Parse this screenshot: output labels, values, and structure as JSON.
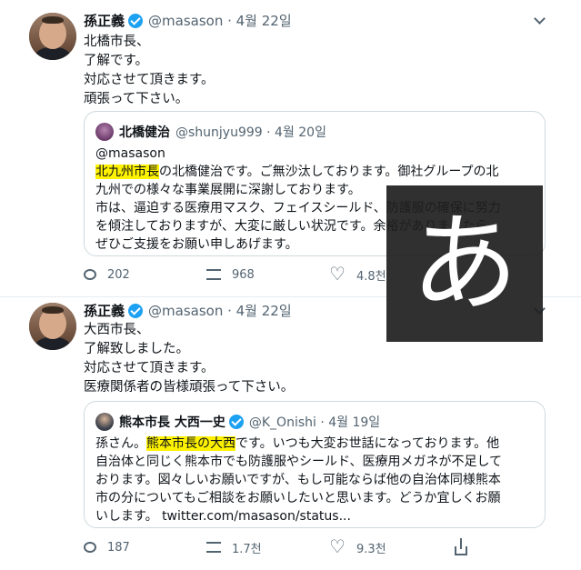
{
  "tweets": [
    {
      "author_name": "孫正義",
      "handle_time": "@masason · 4월 22일",
      "body_lines": [
        "北橋市長、",
        "了解です。",
        "対応させて頂きます。",
        "頑張って下さい。"
      ],
      "quote": {
        "author_name": "北橋健治",
        "handle_time": "@shunjyu999 · 4월 20일",
        "line0": "@masason",
        "line1_hl": "北九州市長",
        "line1_rest": "の北橋健治です。ご無沙汰しております。御社グループの北",
        "line2": "九州での様々な事業展開に深謝しております。",
        "line3": "市は、逼迫する医療用マスク、フェイスシールド、防護服の確保に努力",
        "line4": "を傾注しておりますが、大変に厳しい状況です。余裕がありましたら、",
        "line5": "ぜひご支援をお願い申しあげます。"
      },
      "actions": {
        "replies": "202",
        "retweets": "968",
        "likes": "4.8천"
      }
    },
    {
      "author_name": "孫正義",
      "handle_time": "@masason · 4월 22일",
      "body_lines": [
        "大西市長、",
        "了解致しました。",
        "対応させて頂きます。",
        "医療関係者の皆様頑張って下さい。"
      ],
      "quote": {
        "author_name": "熊本市長 大西一史",
        "handle_time": "@K_Onishi · 4월 19일",
        "line0_pre": "孫さん。",
        "line0_hl": "熊本市長の大西",
        "line0_rest": "です。いつも大変お世話になっております。他",
        "line1": "自治体と同じく熊本市でも防護服やシールド、医療用メガネが不足して",
        "line2": "おります。図々しいお願いですが、もし可能ならば他の自治体同様熊本",
        "line3": "市の分についてもご相談をお願いしたいと思います。どうか宜しくお願",
        "line4_pre": "いします。",
        "line4_link": "twitter.com/masason/status..."
      },
      "actions": {
        "replies": "187",
        "retweets": "1.7천",
        "likes": "9.3천"
      }
    }
  ],
  "overlay": {
    "glyph": "あ"
  },
  "colors": {
    "highlight": "#fff200",
    "verified": "#1da1f2",
    "muted": "#536471"
  },
  "icons": [
    "verified-badge-icon",
    "more-caret-icon",
    "reply-icon",
    "retweet-icon",
    "like-icon",
    "share-icon"
  ]
}
